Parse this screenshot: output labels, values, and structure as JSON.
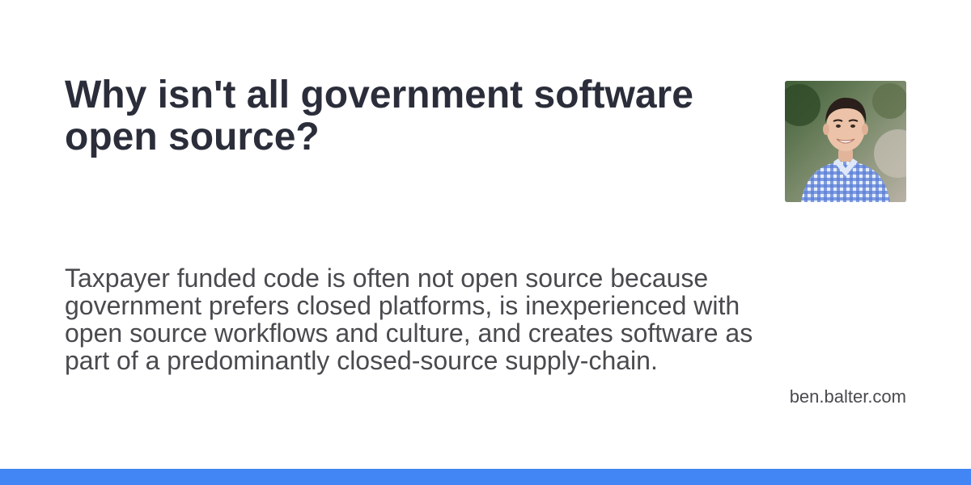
{
  "card": {
    "title": "Why isn't all government software open source?",
    "description": "Taxpayer funded code is often not open source because government prefers closed platforms, is inexperienced with open source workflows and culture, and creates software as part of a predominantly closed-source supply-chain.",
    "site_url": "ben.balter.com",
    "accent_color": "#4285f4"
  }
}
